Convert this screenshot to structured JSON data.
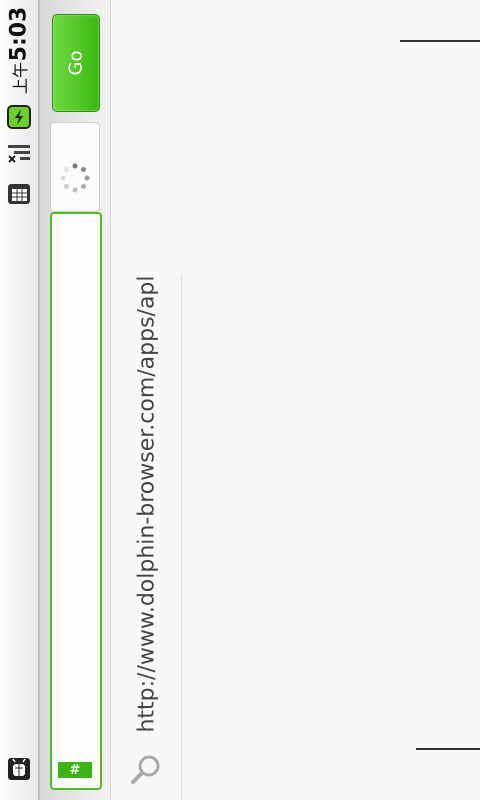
{
  "statusbar": {
    "time": "5:03",
    "ampm": "上午",
    "icons": [
      "battery-charging-icon",
      "signal-icon",
      "calendar-icon",
      "android-debug-icon"
    ]
  },
  "addressbar": {
    "go_label": "Go",
    "hash_label": "#"
  },
  "suggestion": {
    "url": "http://www.dolphin-browser.com/apps/apl"
  },
  "colors": {
    "accent": "#4bbd22",
    "go_button": "#3ab810"
  }
}
